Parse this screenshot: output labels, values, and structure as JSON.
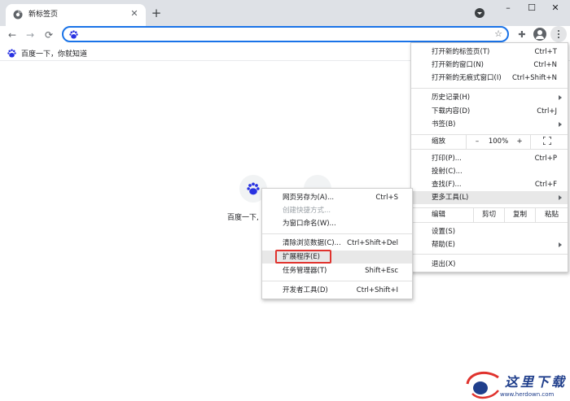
{
  "tab": {
    "title": "新标签页",
    "close": "✕",
    "new_tab": "+"
  },
  "window": {
    "minimize": "–",
    "maximize": "☐",
    "close": "✕"
  },
  "toolbar": {
    "back": "←",
    "forward": "→",
    "reload": "⟳",
    "omnibox_value": "",
    "star": "☆",
    "extensions": "✚"
  },
  "bookmarks": [
    {
      "label": "百度一下，你就知道",
      "icon": "baidu-paw-icon"
    }
  ],
  "ntp": {
    "tile_label": "百度一下,"
  },
  "chrome_menu": {
    "new_tab": {
      "label": "打开新的标签页(T)",
      "shortcut": "Ctrl+T"
    },
    "new_window": {
      "label": "打开新的窗口(N)",
      "shortcut": "Ctrl+N"
    },
    "incognito": {
      "label": "打开新的无痕式窗口(I)",
      "shortcut": "Ctrl+Shift+N"
    },
    "history": {
      "label": "历史记录(H)"
    },
    "downloads": {
      "label": "下载内容(D)",
      "shortcut": "Ctrl+J"
    },
    "bookmarks": {
      "label": "书签(B)"
    },
    "zoom": {
      "label": "缩放",
      "minus": "–",
      "value": "100%",
      "plus": "+"
    },
    "print": {
      "label": "打印(P)...",
      "shortcut": "Ctrl+P"
    },
    "cast": {
      "label": "投射(C)..."
    },
    "find": {
      "label": "查找(F)...",
      "shortcut": "Ctrl+F"
    },
    "more_tools": {
      "label": "更多工具(L)"
    },
    "edit": {
      "label": "编辑",
      "cut": "剪切",
      "copy": "复制",
      "paste": "粘贴"
    },
    "settings": {
      "label": "设置(S)"
    },
    "help": {
      "label": "帮助(E)"
    },
    "exit": {
      "label": "退出(X)"
    }
  },
  "more_tools_menu": {
    "save_page": {
      "label": "网页另存为(A)...",
      "shortcut": "Ctrl+S"
    },
    "create_shortcut": {
      "label": "创建快捷方式..."
    },
    "name_window": {
      "label": "为窗口命名(W)..."
    },
    "clear_data": {
      "label": "清除浏览数据(C)...",
      "shortcut": "Ctrl+Shift+Del"
    },
    "extensions": {
      "label": "扩展程序(E)"
    },
    "task_manager": {
      "label": "任务管理器(T)",
      "shortcut": "Shift+Esc"
    },
    "dev_tools": {
      "label": "开发者工具(D)",
      "shortcut": "Ctrl+Shift+I"
    }
  },
  "watermark": {
    "text": "这里下载",
    "url": "www.herdown.com"
  },
  "colors": {
    "accent": "#1a73e8",
    "highlight_box": "#e0332e",
    "baidu_blue": "#2932e1"
  }
}
